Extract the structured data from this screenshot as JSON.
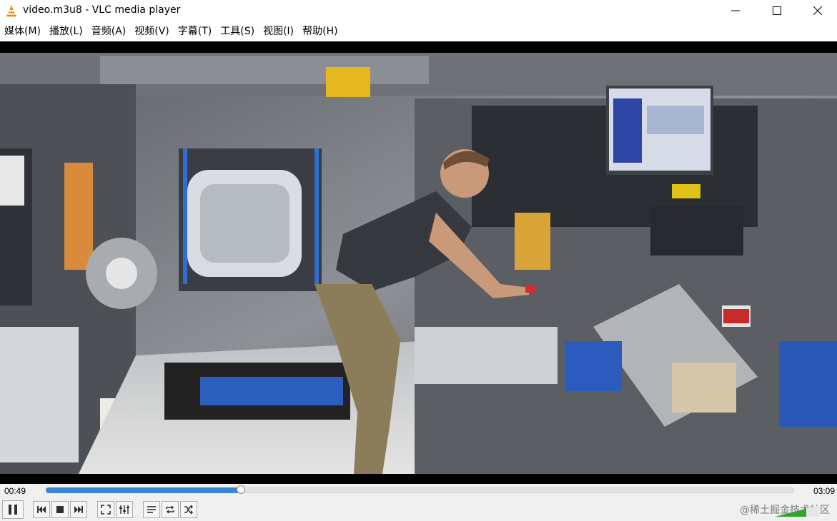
{
  "window": {
    "title": "video.m3u8 - VLC media player"
  },
  "menu": {
    "items": [
      {
        "label": "媒体(M)"
      },
      {
        "label": "播放(L)"
      },
      {
        "label": "音频(A)"
      },
      {
        "label": "视频(V)"
      },
      {
        "label": "字幕(T)"
      },
      {
        "label": "工具(S)"
      },
      {
        "label": "视图(I)"
      },
      {
        "label": "帮助(H)"
      }
    ]
  },
  "player": {
    "elapsed": "00:49",
    "total": "03:09",
    "progress": 0.261
  },
  "controls": {
    "buttons": [
      "pause-icon",
      "previous-icon",
      "stop-icon",
      "next-icon",
      "fullscreen-icon",
      "extended-settings-icon",
      "playlist-icon",
      "loop-icon",
      "shuffle-icon"
    ]
  },
  "watermark": "@稀土掘金技术社区",
  "colors": {
    "accent": "#3a86d6",
    "vlc_orange": "#f28b00"
  }
}
